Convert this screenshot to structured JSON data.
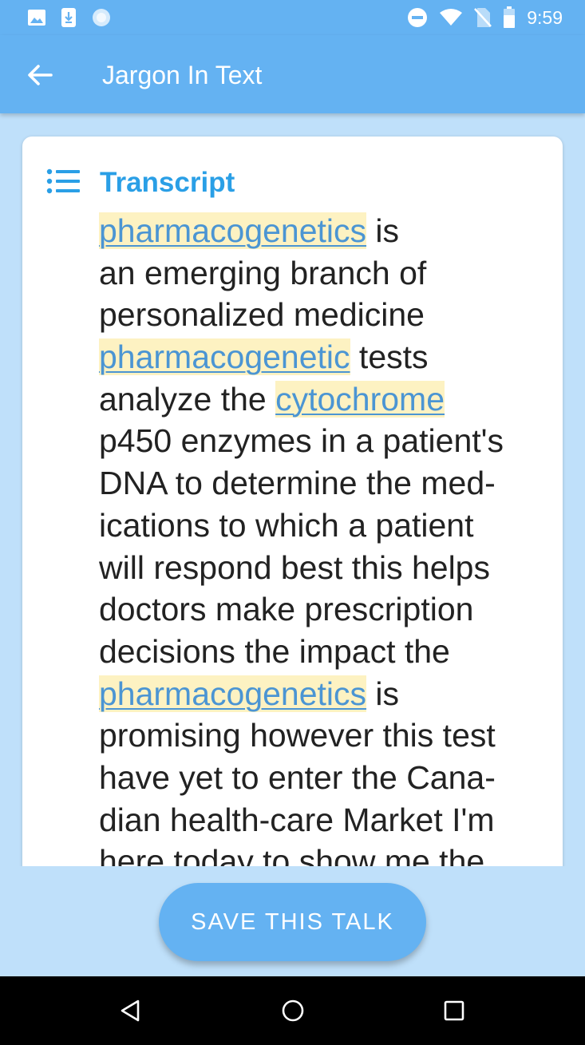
{
  "status_bar": {
    "time": "9:59",
    "left_icons": [
      "image-icon",
      "download-icon",
      "sync-icon"
    ],
    "right_icons": [
      "do-not-disturb-icon",
      "wifi-icon",
      "no-sim-icon",
      "battery-icon"
    ]
  },
  "app_bar": {
    "title": "Jargon In Text",
    "back_icon": "arrow-left-icon",
    "color": "#64b2f2"
  },
  "card": {
    "title": "Transcript",
    "icon": "list-icon",
    "title_color": "#2a9fe6",
    "highlight_color": "#fdf2c2",
    "jargon_color": "#4b95d3",
    "lines": [
      [
        {
          "text": " "
        },
        {
          "text": "pharmacogenetics",
          "jargon": true
        },
        {
          "text": " is"
        }
      ],
      [
        {
          "text": "an emerging branch of"
        }
      ],
      [
        {
          "text": "personalized medicine"
        }
      ],
      [
        {
          "text": "pharmacogenetic",
          "jargon": true
        },
        {
          "text": " tests"
        }
      ],
      [
        {
          "text": "analyze the "
        },
        {
          "text": "cytochrome",
          "jargon": true
        }
      ],
      [
        {
          "text": "p450 enzymes in a patient's"
        }
      ],
      [
        {
          "text": "DNA to determine the med-"
        }
      ],
      [
        {
          "text": "ications to which a patient"
        }
      ],
      [
        {
          "text": "will respond best this helps"
        }
      ],
      [
        {
          "text": "doctors make prescription"
        }
      ],
      [
        {
          "text": "decisions the impact the"
        }
      ],
      [
        {
          "text": "pharmacogenetics",
          "jargon": true
        },
        {
          "text": " is"
        }
      ],
      [
        {
          "text": "promising however this test"
        }
      ],
      [
        {
          "text": "have yet to enter the Cana-"
        }
      ],
      [
        {
          "text": "dian health-care Market I'm"
        }
      ],
      [
        {
          "text": "here today to show me the"
        }
      ]
    ]
  },
  "save_button": {
    "label": "SAVE THIS TALK"
  },
  "nav_bar": {
    "icons": [
      "back-triangle-icon",
      "home-circle-icon",
      "recents-square-icon"
    ]
  }
}
